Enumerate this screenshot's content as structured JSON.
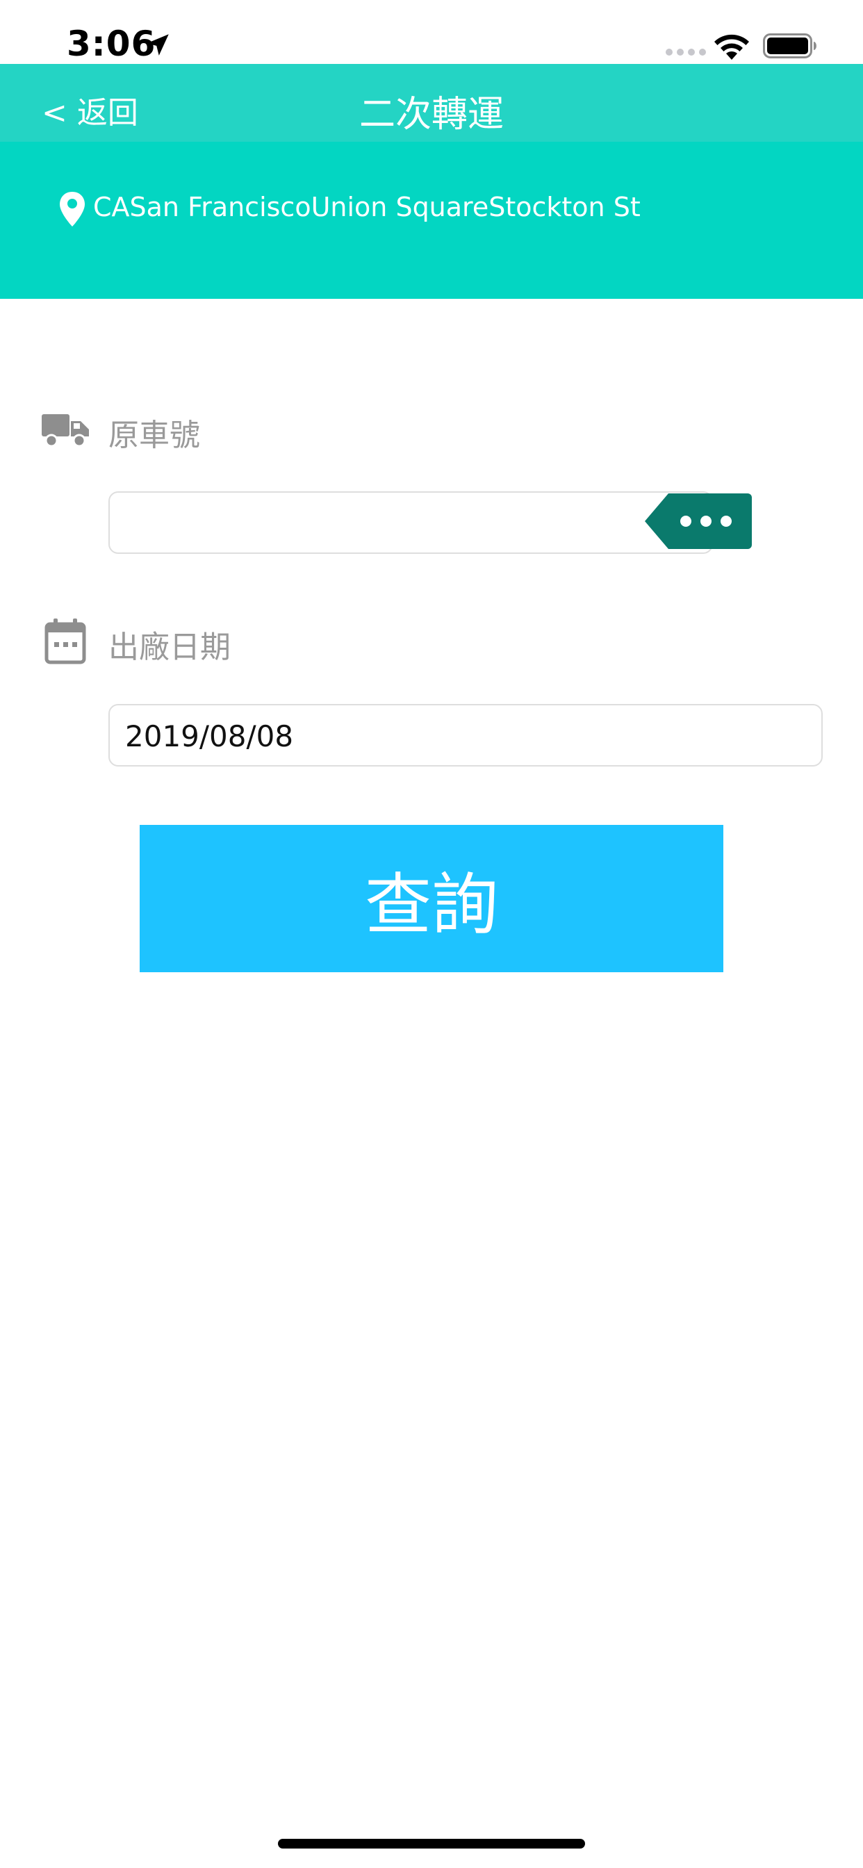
{
  "status_bar": {
    "time": "3:06",
    "icons": [
      "location-arrow-icon",
      "signal-dots-icon",
      "wifi-icon",
      "battery-icon"
    ]
  },
  "nav_bar": {
    "back_label": "< 返回",
    "title": "二次轉運"
  },
  "location": {
    "icon": "map-pin-icon",
    "address": "CASan FranciscoUnion SquareStockton St"
  },
  "form": {
    "vehicle": {
      "icon": "truck-icon",
      "label": "原車號",
      "value": "",
      "more_icon": "ellipsis-icon"
    },
    "date": {
      "icon": "calendar-icon",
      "label": "出廠日期",
      "value": "2019/08/08"
    },
    "submit_label": "查詢"
  },
  "colors": {
    "nav_bar": "#24d4c4",
    "location_banner": "#03d6c2",
    "more_button": "#0a7a6c",
    "query_button": "#1ec3ff",
    "label_text": "#9a9a9a"
  }
}
